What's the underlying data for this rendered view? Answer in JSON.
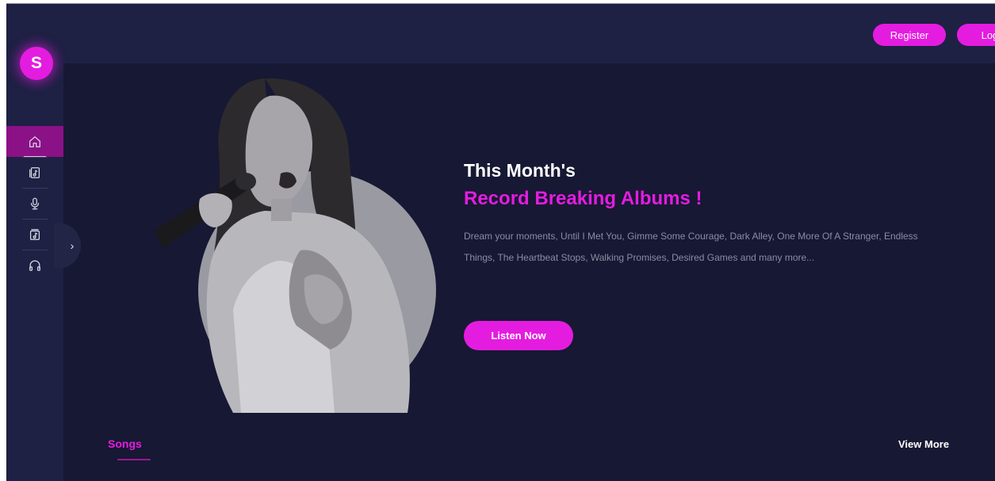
{
  "brand": {
    "logo_letter": "S"
  },
  "sidebar": {
    "items": [
      {
        "name": "home",
        "icon": "home-icon",
        "active": true
      },
      {
        "name": "music-library",
        "icon": "music-library-icon",
        "active": false
      },
      {
        "name": "microphone",
        "icon": "microphone-icon",
        "active": false
      },
      {
        "name": "albums",
        "icon": "album-icon",
        "active": false
      },
      {
        "name": "headphones",
        "icon": "headphones-icon",
        "active": false
      }
    ],
    "collapse_icon": "chevron-right-icon"
  },
  "header": {
    "register_label": "Register",
    "login_label": "Login"
  },
  "hero": {
    "title_line1": "This Month's",
    "title_line2": "Record Breaking Albums !",
    "description": "Dream your moments, Until I Met You, Gimme Some Courage, Dark Alley, One More Of A Stranger, Endless Things, The Heartbeat Stops, Walking Promises, Desired Games and many more...",
    "cta_label": "Listen Now",
    "image": "singer-with-microphone-photo"
  },
  "section": {
    "tab_label": "Songs",
    "view_more_label": "View More"
  },
  "colors": {
    "accent": "#e41ce0",
    "background": "#171833",
    "panel": "#1e2044",
    "active_nav": "#8b1187",
    "muted_text": "#8b8ca3"
  }
}
